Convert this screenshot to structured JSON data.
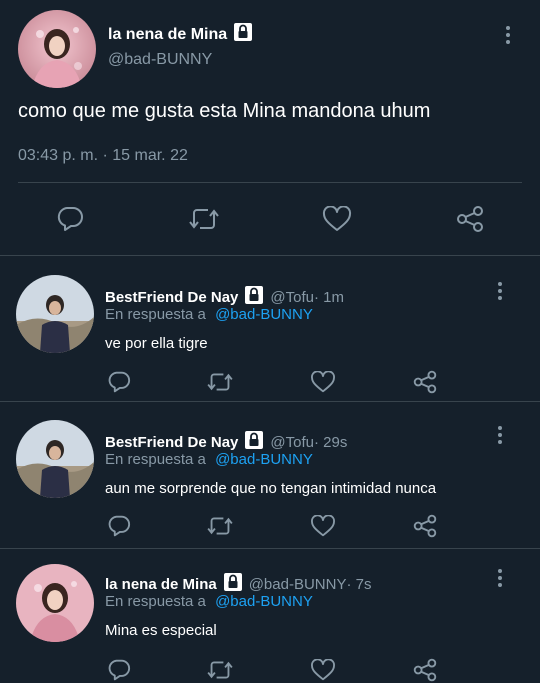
{
  "main_tweet": {
    "name": "la nena de Mina",
    "handle": "@bad-BUNNY",
    "text": "como que me gusta esta Mina mandona uhum",
    "timestamp": "03:43 p. m. · 15 mar. 22",
    "icons": [
      "lock-icon",
      "more-vertical-icon",
      "reply-icon",
      "retweet-icon",
      "like-icon",
      "share-icon"
    ]
  },
  "replies": [
    {
      "name": "BestFriend De Nay",
      "handle": "@Tofu",
      "time": " · 1m",
      "reply_label": "En respuesta a",
      "reply_to": "@bad-BUNNY",
      "text": "ve por ella tigre"
    },
    {
      "name": "BestFriend De Nay",
      "handle": "@Tofu",
      "time": " · 29s",
      "reply_label": "En respuesta a",
      "reply_to": "@bad-BUNNY",
      "text": "aun me sorprende que no tengan intimidad nunca"
    },
    {
      "name": "la nena de Mina",
      "handle": "@bad-BUNNY",
      "time": " · 7s",
      "reply_label": "En respuesta a",
      "reply_to": "@bad-BUNNY",
      "text": "Mina es especial"
    }
  ],
  "colors": {
    "background": "#15202b",
    "divider": "#38444d",
    "secondary_text": "#8899a6",
    "link": "#1da1f2"
  }
}
